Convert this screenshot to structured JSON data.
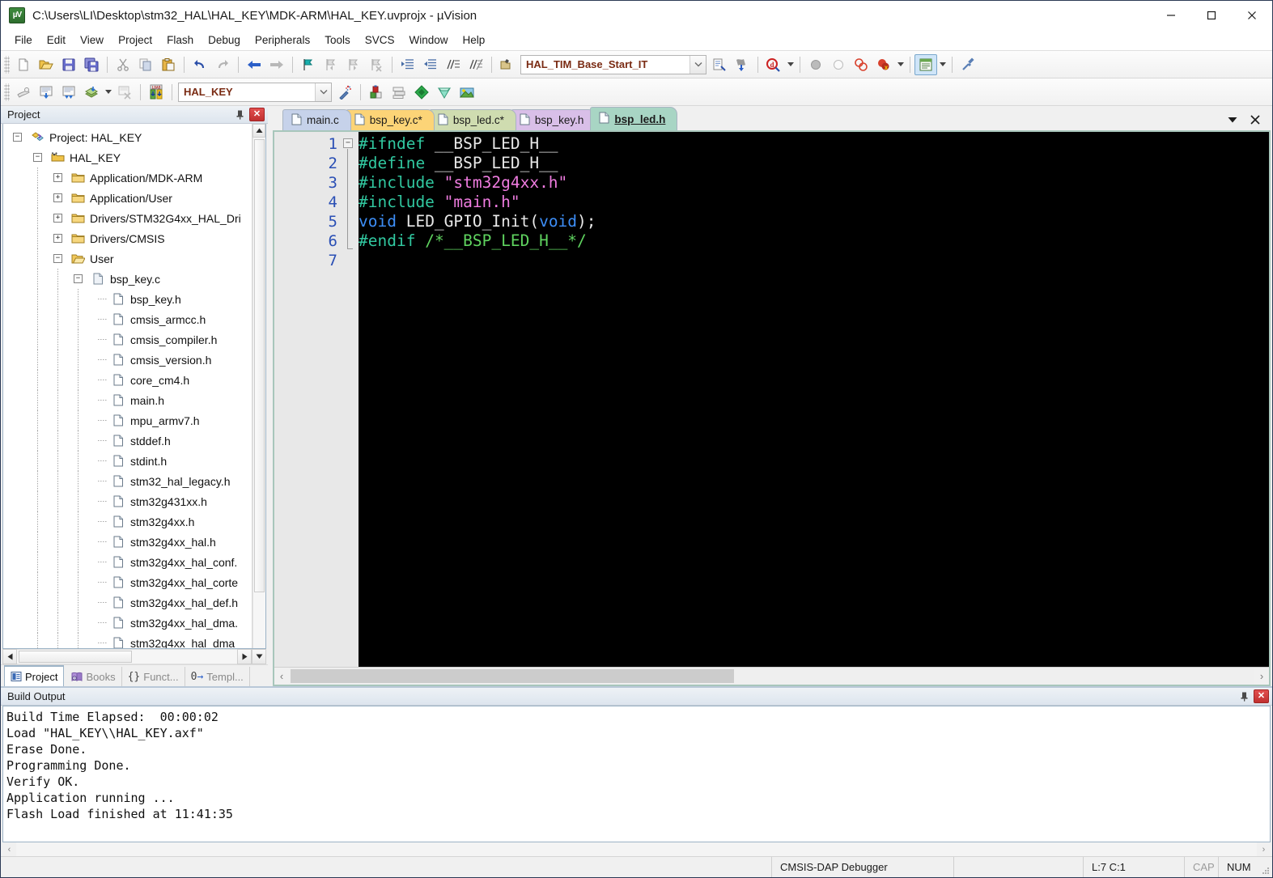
{
  "window": {
    "title": "C:\\Users\\LI\\Desktop\\stm32_HAL\\HAL_KEY\\MDK-ARM\\HAL_KEY.uvprojx - µVision",
    "app_icon": "uvision-icon",
    "minimize": "–",
    "maximize": "☐",
    "close": "✕"
  },
  "menubar": {
    "items": [
      {
        "label": "File"
      },
      {
        "label": "Edit"
      },
      {
        "label": "View"
      },
      {
        "label": "Project"
      },
      {
        "label": "Flash"
      },
      {
        "label": "Debug"
      },
      {
        "label": "Peripherals"
      },
      {
        "label": "Tools"
      },
      {
        "label": "SVCS"
      },
      {
        "label": "Window"
      },
      {
        "label": "Help"
      }
    ]
  },
  "toolbar_main": {
    "buttons": [
      {
        "name": "new-file-icon"
      },
      {
        "name": "open-file-icon"
      },
      {
        "name": "save-icon"
      },
      {
        "name": "save-all-icon"
      },
      {
        "name": "cut-icon"
      },
      {
        "name": "copy-icon"
      },
      {
        "name": "paste-icon"
      },
      {
        "name": "undo-icon"
      },
      {
        "name": "redo-icon"
      },
      {
        "name": "navigate-back-icon"
      },
      {
        "name": "navigate-forward-icon"
      },
      {
        "name": "bookmark-toggle-icon"
      },
      {
        "name": "bookmark-prev-icon"
      },
      {
        "name": "bookmark-next-icon"
      },
      {
        "name": "bookmark-clear-icon"
      },
      {
        "name": "indent-increase-icon"
      },
      {
        "name": "indent-decrease-icon"
      },
      {
        "name": "comment-lines-icon"
      },
      {
        "name": "uncomment-lines-icon"
      }
    ],
    "function_combo_value": "HAL_TIM_Base_Start_IT",
    "after_combo": [
      {
        "name": "insert-file-icon"
      },
      {
        "name": "go-to-definition-icon"
      },
      {
        "name": "find-in-files-icon"
      },
      {
        "name": "start-debug-icon"
      },
      {
        "name": "stop-debug-icon"
      },
      {
        "name": "breakpoint-toggle-icon"
      },
      {
        "name": "breakpoint-clear-icon"
      },
      {
        "name": "window-manager-icon"
      },
      {
        "name": "configure-icon"
      }
    ]
  },
  "toolbar_build": {
    "buttons": [
      {
        "name": "translate-file-icon"
      },
      {
        "name": "build-target-icon"
      },
      {
        "name": "rebuild-all-icon"
      },
      {
        "name": "batch-build-icon"
      },
      {
        "name": "stop-build-icon"
      },
      {
        "name": "download-to-flash-icon"
      }
    ],
    "target_combo_value": "HAL_KEY",
    "after_combo": [
      {
        "name": "target-options-wizard-icon"
      },
      {
        "name": "manage-project-items-icon"
      },
      {
        "name": "manage-multi-project-icon"
      },
      {
        "name": "pack-installer-icon"
      },
      {
        "name": "run-time-environment-icon"
      },
      {
        "name": "manage-run-time-icon"
      }
    ]
  },
  "project_panel": {
    "title": "Project",
    "pin_icon": "pin-icon",
    "close_icon": "close-icon",
    "tree": [
      {
        "label": "Project: HAL_KEY",
        "depth": 0,
        "expander": "-",
        "icon": "project-icon"
      },
      {
        "label": "HAL_KEY",
        "depth": 1,
        "expander": "-",
        "icon": "target-icon"
      },
      {
        "label": "Application/MDK-ARM",
        "depth": 2,
        "expander": "+",
        "icon": "folder-closed-icon"
      },
      {
        "label": "Application/User",
        "depth": 2,
        "expander": "+",
        "icon": "folder-closed-icon"
      },
      {
        "label": "Drivers/STM32G4xx_HAL_Dri",
        "depth": 2,
        "expander": "+",
        "icon": "folder-closed-icon"
      },
      {
        "label": "Drivers/CMSIS",
        "depth": 2,
        "expander": "+",
        "icon": "folder-closed-icon"
      },
      {
        "label": "User",
        "depth": 2,
        "expander": "-",
        "icon": "folder-open-icon"
      },
      {
        "label": "bsp_key.c",
        "depth": 3,
        "expander": "-",
        "icon": "source-file-icon"
      },
      {
        "label": "bsp_key.h",
        "depth": 4,
        "expander": "",
        "icon": "header-file-icon"
      },
      {
        "label": "cmsis_armcc.h",
        "depth": 4,
        "expander": "",
        "icon": "header-file-icon"
      },
      {
        "label": "cmsis_compiler.h",
        "depth": 4,
        "expander": "",
        "icon": "header-file-icon"
      },
      {
        "label": "cmsis_version.h",
        "depth": 4,
        "expander": "",
        "icon": "header-file-icon"
      },
      {
        "label": "core_cm4.h",
        "depth": 4,
        "expander": "",
        "icon": "header-file-icon"
      },
      {
        "label": "main.h",
        "depth": 4,
        "expander": "",
        "icon": "header-file-icon"
      },
      {
        "label": "mpu_armv7.h",
        "depth": 4,
        "expander": "",
        "icon": "header-file-icon"
      },
      {
        "label": "stddef.h",
        "depth": 4,
        "expander": "",
        "icon": "header-file-icon"
      },
      {
        "label": "stdint.h",
        "depth": 4,
        "expander": "",
        "icon": "header-file-icon"
      },
      {
        "label": "stm32_hal_legacy.h",
        "depth": 4,
        "expander": "",
        "icon": "header-file-icon"
      },
      {
        "label": "stm32g431xx.h",
        "depth": 4,
        "expander": "",
        "icon": "header-file-icon"
      },
      {
        "label": "stm32g4xx.h",
        "depth": 4,
        "expander": "",
        "icon": "header-file-icon"
      },
      {
        "label": "stm32g4xx_hal.h",
        "depth": 4,
        "expander": "",
        "icon": "header-file-icon"
      },
      {
        "label": "stm32g4xx_hal_conf.",
        "depth": 4,
        "expander": "",
        "icon": "header-file-icon"
      },
      {
        "label": "stm32g4xx_hal_corte",
        "depth": 4,
        "expander": "",
        "icon": "header-file-icon"
      },
      {
        "label": "stm32g4xx_hal_def.h",
        "depth": 4,
        "expander": "",
        "icon": "header-file-icon"
      },
      {
        "label": "stm32g4xx_hal_dma.",
        "depth": 4,
        "expander": "",
        "icon": "header-file-icon"
      },
      {
        "label": "stm32g4xx_hal_dma",
        "depth": 4,
        "expander": "",
        "icon": "header-file-icon"
      }
    ],
    "tabs": [
      {
        "label": "Project",
        "icon": "project-tab-icon",
        "selected": true
      },
      {
        "label": "Books",
        "icon": "books-tab-icon",
        "selected": false
      },
      {
        "label": "Funct...",
        "icon": "functions-tab-icon",
        "selected": false
      },
      {
        "label": "Templ...",
        "icon": "templates-tab-icon",
        "selected": false
      }
    ]
  },
  "editor": {
    "tabs": [
      {
        "label": "main.c",
        "color": "#c6d2ea",
        "selected": false
      },
      {
        "label": "bsp_key.c*",
        "color": "#fcd477",
        "selected": false
      },
      {
        "label": "bsp_led.c*",
        "color": "#cfdcb0",
        "selected": false
      },
      {
        "label": "bsp_key.h",
        "color": "#d9bfe8",
        "selected": false
      },
      {
        "label": "bsp_led.h",
        "color": "#a8d5c4",
        "selected": true
      }
    ],
    "tab_list_icon": "chevron-down-icon",
    "tab_close_icon": "close-icon",
    "line_numbers": [
      "1",
      "2",
      "3",
      "4",
      "5",
      "6",
      "7"
    ],
    "lines": [
      {
        "n": 1,
        "tokens": [
          {
            "t": "#ifndef",
            "c": "k-pre"
          },
          {
            "t": " __BSP_LED_H__",
            "c": "k-id"
          }
        ]
      },
      {
        "n": 2,
        "tokens": [
          {
            "t": "#define",
            "c": "k-pre"
          },
          {
            "t": " __BSP_LED_H__",
            "c": "k-id"
          }
        ]
      },
      {
        "n": 3,
        "tokens": [
          {
            "t": "#include",
            "c": "k-pre"
          },
          {
            "t": " ",
            "c": "k-id"
          },
          {
            "t": "\"stm32g4xx.h\"",
            "c": "k-str"
          }
        ]
      },
      {
        "n": 4,
        "tokens": [
          {
            "t": "#include",
            "c": "k-pre"
          },
          {
            "t": " ",
            "c": "k-id"
          },
          {
            "t": "\"main.h\"",
            "c": "k-str"
          }
        ]
      },
      {
        "n": 5,
        "tokens": [
          {
            "t": "void",
            "c": "k-kw"
          },
          {
            "t": " LED_GPIO_Init(",
            "c": "k-id"
          },
          {
            "t": "void",
            "c": "k-kw"
          },
          {
            "t": ");",
            "c": "k-pun"
          }
        ]
      },
      {
        "n": 6,
        "tokens": [
          {
            "t": "#endif",
            "c": "k-pre"
          },
          {
            "t": " ",
            "c": "k-id"
          },
          {
            "t": "/*__BSP_LED_H__*/",
            "c": "k-cmt"
          }
        ]
      },
      {
        "n": 7,
        "tokens": []
      }
    ]
  },
  "build_output": {
    "title": "Build Output",
    "pin_icon": "pin-icon",
    "close_icon": "close-icon",
    "lines": [
      "Build Time Elapsed:  00:00:02",
      "Load \"HAL_KEY\\\\HAL_KEY.axf\"",
      "Erase Done.",
      "Programming Done.",
      "Verify OK.",
      "Application running ...",
      "Flash Load finished at 11:41:35"
    ]
  },
  "statusbar": {
    "debugger": "CMSIS-DAP Debugger",
    "message": "",
    "cursor": "L:7 C:1",
    "caps": "CAP",
    "num": "NUM"
  }
}
